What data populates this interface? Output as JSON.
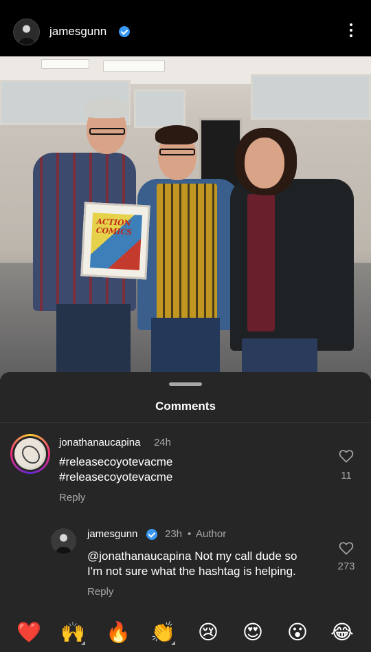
{
  "header": {
    "username": "jamesgunn",
    "verified": true,
    "more_icon": "vertical-ellipsis-icon"
  },
  "photo": {
    "comic_title": "ACTION COMICS"
  },
  "comments_sheet": {
    "title": "Comments",
    "comments": [
      {
        "username": "jonathanaucapina",
        "time": "24h",
        "text_line1": "#releasecoyotevacme",
        "text_line2": "#releasecoyotevacme",
        "reply_label": "Reply",
        "likes": "11"
      },
      {
        "username": "jamesgunn",
        "verified": true,
        "time": "23h",
        "separator": "•",
        "author_label": "Author",
        "text_line1": "@jonathanaucapina Not my call dude so",
        "text_line2": "I'm not sure what the hashtag is helping.",
        "reply_label": "Reply",
        "likes": "273"
      }
    ]
  },
  "emoji_bar": [
    "❤️",
    "🙌",
    "🔥",
    "👏",
    "😢",
    "😍",
    "😮",
    "😂"
  ],
  "colors": {
    "background": "#000000",
    "sheet": "#262626",
    "secondary_text": "#a8a8a8",
    "verified_blue": "#3897f0"
  }
}
